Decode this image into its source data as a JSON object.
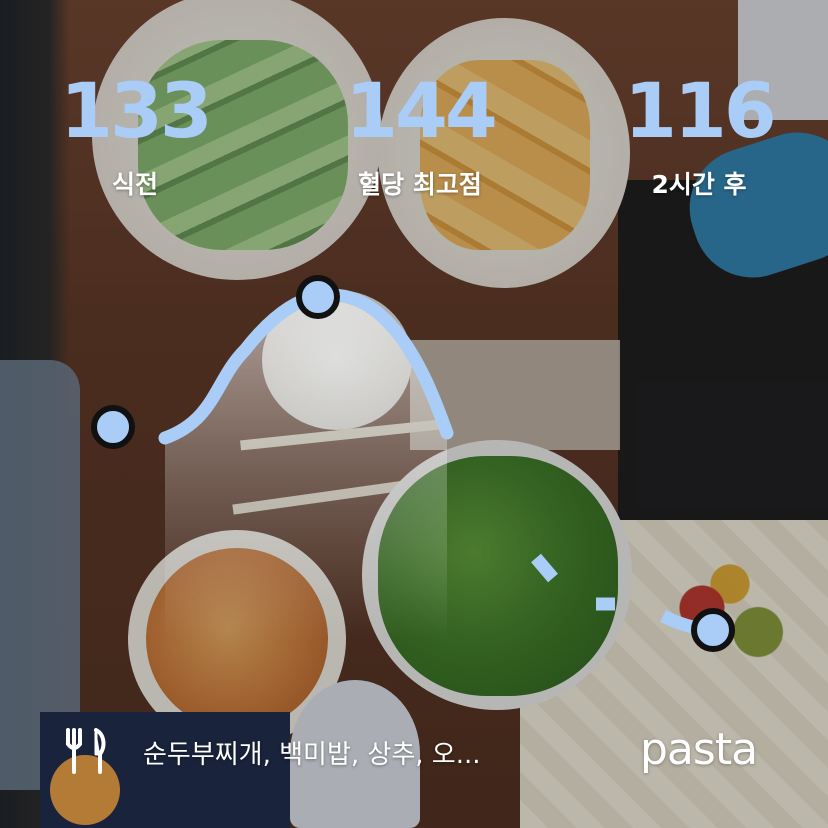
{
  "stats": {
    "before": {
      "value": "133",
      "label": "식전"
    },
    "peak": {
      "value": "144",
      "label": "혈당 최고점"
    },
    "after": {
      "value": "116",
      "label": "2시간 후"
    }
  },
  "meal": {
    "icon": "fork-knife-icon",
    "text": "순두부찌개, 백미밥, 상추, 오..."
  },
  "brand": "pasta",
  "colors": {
    "accent": "#a9cdf7",
    "marker_outline": "#111111",
    "text": "#ffffff"
  }
}
